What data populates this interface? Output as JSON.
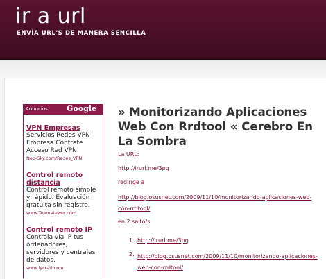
{
  "header": {
    "title": "ir a url",
    "tagline": "ENVÍA URL'S DE MANERA SENCILLA"
  },
  "ads": {
    "label": "Anuncios",
    "brand": "Google",
    "items": [
      {
        "title": "VPN Empresas",
        "desc": "Servicios Redes VPN Empresa Contrate Acceso Red VPN",
        "url": "Neo-Sky.com/Redes_VPN"
      },
      {
        "title": "Control remoto distancia",
        "desc": "Control remoto simple y rápido. Evaluación gratuita sin registro.",
        "url": "www.TeamViewer.com"
      },
      {
        "title": "Control remoto IP",
        "desc": "Controla vía IP tus ordenadores, servidores y centrales de datos.",
        "url": "www.lycrati.com"
      }
    ]
  },
  "post": {
    "title": "» Monitorizando Aplicaciones Web Con Rrdtool « Cerebro En La Sombra",
    "url_label": "La URL:",
    "short_url": "http://irurl.me/3pq",
    "redirects_label": "redirige a",
    "long_url": "http://blog.osusnet.com/2009/11/10/monitorizando-aplicaciones-web-con-rrdtool/",
    "hops": "en 2 salto/s",
    "list": [
      {
        "num": "1.",
        "text": "http://irurl.me/3pq"
      },
      {
        "num": "2.",
        "text": "http://blog.osusnet.com/2009/11/10/monitorizando-aplicaciones-web-con-rrdtool/"
      }
    ]
  },
  "colors": {
    "header": "#4a0f26",
    "accent": "#8a1c4a",
    "link": "#7a1035"
  }
}
